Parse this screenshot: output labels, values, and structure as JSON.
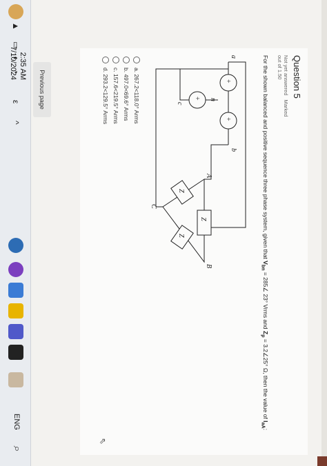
{
  "question": {
    "title": "Question 5",
    "status": "Not yet answered",
    "mark": "Marked out of 1.50",
    "text_prefix": "For the shown balanced and positive sequence three phase system, given that ",
    "v_symbol": "V",
    "v_sub": "bn",
    "v_value": " = 285∠ 23° Vrms and ",
    "z_symbol": "Z",
    "z_sub": "p",
    "z_value": " = 3.2∠25° Ω, then the value of ",
    "i_symbol": "I",
    "i_sub": "aA",
    "text_suffix": ":"
  },
  "circuit": {
    "node_a": "a",
    "node_b": "b",
    "node_c": "c",
    "node_n": "n",
    "node_A": "A",
    "node_B": "B",
    "node_C": "C",
    "impedance_label": "Z",
    "impedance_sub": "p",
    "source_sign_plus": "+",
    "source_sign_minus": "−"
  },
  "answers": [
    {
      "label": "a. 267.2<118.0° Arms"
    },
    {
      "label": "b. 497.0<69.6° Arms"
    },
    {
      "label": "c. 157.6<219.5° Arms"
    },
    {
      "label": "d. 293.2<129.5° Arms"
    }
  ],
  "navigation": {
    "previous_label": "Previous page"
  },
  "taskbar": {
    "time": "2:35 AM",
    "date": "7/10/2024",
    "language": "ENG",
    "chevron": "^"
  },
  "colors": {
    "page_bg": "#f3f2ef",
    "card_bg": "#fbfbfa",
    "taskbar_bg": "#e9ecf0"
  }
}
